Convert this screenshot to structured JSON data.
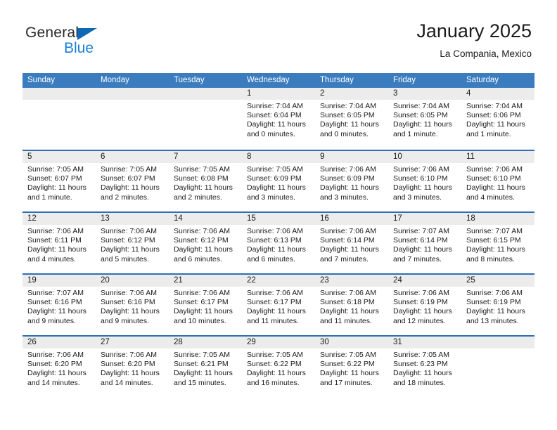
{
  "brand": {
    "line1": "General",
    "line2": "Blue",
    "triangle_color": "#0f69b4",
    "blue_text_color": "#1a7fd4"
  },
  "header": {
    "title": "January 2025",
    "subtitle": "La Compania, Mexico"
  },
  "colors": {
    "header_row_bg": "#3b7cbf",
    "week_divider": "#2f6fb5",
    "datenum_bg": "#ececec",
    "text": "#1b1b1b"
  },
  "weekdays": [
    "Sunday",
    "Monday",
    "Tuesday",
    "Wednesday",
    "Thursday",
    "Friday",
    "Saturday"
  ],
  "weeks": [
    [
      {
        "day": "",
        "empty": true,
        "sunrise": "",
        "sunset": "",
        "daylight1": "",
        "daylight2": ""
      },
      {
        "day": "",
        "empty": true,
        "sunrise": "",
        "sunset": "",
        "daylight1": "",
        "daylight2": ""
      },
      {
        "day": "",
        "empty": true,
        "sunrise": "",
        "sunset": "",
        "daylight1": "",
        "daylight2": ""
      },
      {
        "day": "1",
        "sunrise": "Sunrise: 7:04 AM",
        "sunset": "Sunset: 6:04 PM",
        "daylight1": "Daylight: 11 hours",
        "daylight2": "and 0 minutes."
      },
      {
        "day": "2",
        "sunrise": "Sunrise: 7:04 AM",
        "sunset": "Sunset: 6:05 PM",
        "daylight1": "Daylight: 11 hours",
        "daylight2": "and 0 minutes."
      },
      {
        "day": "3",
        "sunrise": "Sunrise: 7:04 AM",
        "sunset": "Sunset: 6:05 PM",
        "daylight1": "Daylight: 11 hours",
        "daylight2": "and 1 minute."
      },
      {
        "day": "4",
        "sunrise": "Sunrise: 7:04 AM",
        "sunset": "Sunset: 6:06 PM",
        "daylight1": "Daylight: 11 hours",
        "daylight2": "and 1 minute."
      }
    ],
    [
      {
        "day": "5",
        "sunrise": "Sunrise: 7:05 AM",
        "sunset": "Sunset: 6:07 PM",
        "daylight1": "Daylight: 11 hours",
        "daylight2": "and 1 minute."
      },
      {
        "day": "6",
        "sunrise": "Sunrise: 7:05 AM",
        "sunset": "Sunset: 6:07 PM",
        "daylight1": "Daylight: 11 hours",
        "daylight2": "and 2 minutes."
      },
      {
        "day": "7",
        "sunrise": "Sunrise: 7:05 AM",
        "sunset": "Sunset: 6:08 PM",
        "daylight1": "Daylight: 11 hours",
        "daylight2": "and 2 minutes."
      },
      {
        "day": "8",
        "sunrise": "Sunrise: 7:05 AM",
        "sunset": "Sunset: 6:09 PM",
        "daylight1": "Daylight: 11 hours",
        "daylight2": "and 3 minutes."
      },
      {
        "day": "9",
        "sunrise": "Sunrise: 7:06 AM",
        "sunset": "Sunset: 6:09 PM",
        "daylight1": "Daylight: 11 hours",
        "daylight2": "and 3 minutes."
      },
      {
        "day": "10",
        "sunrise": "Sunrise: 7:06 AM",
        "sunset": "Sunset: 6:10 PM",
        "daylight1": "Daylight: 11 hours",
        "daylight2": "and 3 minutes."
      },
      {
        "day": "11",
        "sunrise": "Sunrise: 7:06 AM",
        "sunset": "Sunset: 6:10 PM",
        "daylight1": "Daylight: 11 hours",
        "daylight2": "and 4 minutes."
      }
    ],
    [
      {
        "day": "12",
        "sunrise": "Sunrise: 7:06 AM",
        "sunset": "Sunset: 6:11 PM",
        "daylight1": "Daylight: 11 hours",
        "daylight2": "and 4 minutes."
      },
      {
        "day": "13",
        "sunrise": "Sunrise: 7:06 AM",
        "sunset": "Sunset: 6:12 PM",
        "daylight1": "Daylight: 11 hours",
        "daylight2": "and 5 minutes."
      },
      {
        "day": "14",
        "sunrise": "Sunrise: 7:06 AM",
        "sunset": "Sunset: 6:12 PM",
        "daylight1": "Daylight: 11 hours",
        "daylight2": "and 6 minutes."
      },
      {
        "day": "15",
        "sunrise": "Sunrise: 7:06 AM",
        "sunset": "Sunset: 6:13 PM",
        "daylight1": "Daylight: 11 hours",
        "daylight2": "and 6 minutes."
      },
      {
        "day": "16",
        "sunrise": "Sunrise: 7:06 AM",
        "sunset": "Sunset: 6:14 PM",
        "daylight1": "Daylight: 11 hours",
        "daylight2": "and 7 minutes."
      },
      {
        "day": "17",
        "sunrise": "Sunrise: 7:07 AM",
        "sunset": "Sunset: 6:14 PM",
        "daylight1": "Daylight: 11 hours",
        "daylight2": "and 7 minutes."
      },
      {
        "day": "18",
        "sunrise": "Sunrise: 7:07 AM",
        "sunset": "Sunset: 6:15 PM",
        "daylight1": "Daylight: 11 hours",
        "daylight2": "and 8 minutes."
      }
    ],
    [
      {
        "day": "19",
        "sunrise": "Sunrise: 7:07 AM",
        "sunset": "Sunset: 6:16 PM",
        "daylight1": "Daylight: 11 hours",
        "daylight2": "and 9 minutes."
      },
      {
        "day": "20",
        "sunrise": "Sunrise: 7:06 AM",
        "sunset": "Sunset: 6:16 PM",
        "daylight1": "Daylight: 11 hours",
        "daylight2": "and 9 minutes."
      },
      {
        "day": "21",
        "sunrise": "Sunrise: 7:06 AM",
        "sunset": "Sunset: 6:17 PM",
        "daylight1": "Daylight: 11 hours",
        "daylight2": "and 10 minutes."
      },
      {
        "day": "22",
        "sunrise": "Sunrise: 7:06 AM",
        "sunset": "Sunset: 6:17 PM",
        "daylight1": "Daylight: 11 hours",
        "daylight2": "and 11 minutes."
      },
      {
        "day": "23",
        "sunrise": "Sunrise: 7:06 AM",
        "sunset": "Sunset: 6:18 PM",
        "daylight1": "Daylight: 11 hours",
        "daylight2": "and 11 minutes."
      },
      {
        "day": "24",
        "sunrise": "Sunrise: 7:06 AM",
        "sunset": "Sunset: 6:19 PM",
        "daylight1": "Daylight: 11 hours",
        "daylight2": "and 12 minutes."
      },
      {
        "day": "25",
        "sunrise": "Sunrise: 7:06 AM",
        "sunset": "Sunset: 6:19 PM",
        "daylight1": "Daylight: 11 hours",
        "daylight2": "and 13 minutes."
      }
    ],
    [
      {
        "day": "26",
        "sunrise": "Sunrise: 7:06 AM",
        "sunset": "Sunset: 6:20 PM",
        "daylight1": "Daylight: 11 hours",
        "daylight2": "and 14 minutes."
      },
      {
        "day": "27",
        "sunrise": "Sunrise: 7:06 AM",
        "sunset": "Sunset: 6:20 PM",
        "daylight1": "Daylight: 11 hours",
        "daylight2": "and 14 minutes."
      },
      {
        "day": "28",
        "sunrise": "Sunrise: 7:05 AM",
        "sunset": "Sunset: 6:21 PM",
        "daylight1": "Daylight: 11 hours",
        "daylight2": "and 15 minutes."
      },
      {
        "day": "29",
        "sunrise": "Sunrise: 7:05 AM",
        "sunset": "Sunset: 6:22 PM",
        "daylight1": "Daylight: 11 hours",
        "daylight2": "and 16 minutes."
      },
      {
        "day": "30",
        "sunrise": "Sunrise: 7:05 AM",
        "sunset": "Sunset: 6:22 PM",
        "daylight1": "Daylight: 11 hours",
        "daylight2": "and 17 minutes."
      },
      {
        "day": "31",
        "sunrise": "Sunrise: 7:05 AM",
        "sunset": "Sunset: 6:23 PM",
        "daylight1": "Daylight: 11 hours",
        "daylight2": "and 18 minutes."
      },
      {
        "day": "",
        "empty": true,
        "sunrise": "",
        "sunset": "",
        "daylight1": "",
        "daylight2": ""
      }
    ]
  ]
}
